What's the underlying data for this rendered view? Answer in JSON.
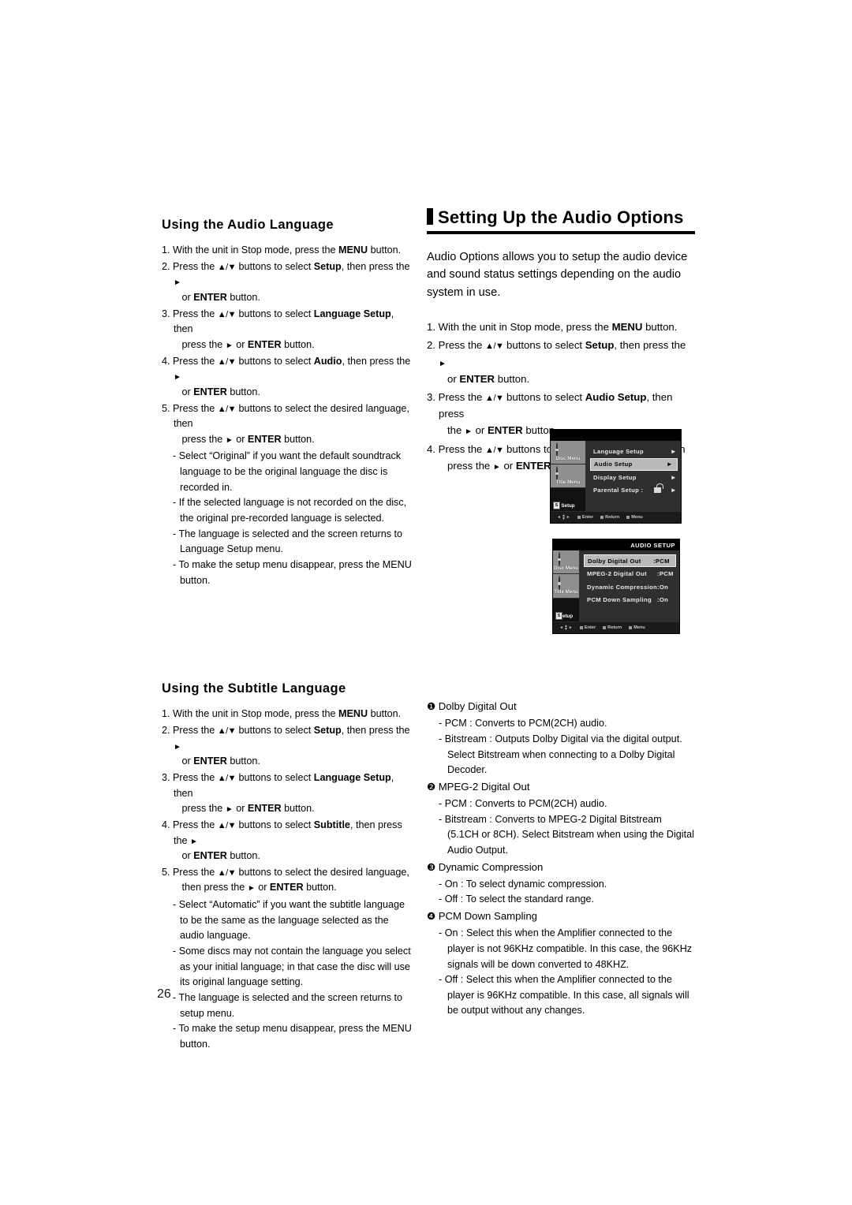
{
  "page_number": "26",
  "left_column": {
    "section1": {
      "title": "Using the Audio Language",
      "steps": [
        "1. With the unit in Stop mode, press the <b>MENU</b> button.",
        "2. Press the <span class=\"tri-ud\"><b>▲</b>/<b>▼</b></span> buttons to select <b>Setup</b>, then press the <span class=\"tri-r\">►</span><br>&nbsp;&nbsp;&nbsp;or <b>ENTER</b> button.",
        "3. Press the <span class=\"tri-ud\"><b>▲</b>/<b>▼</b></span> buttons to select <b>Language Setup</b>, then<br>&nbsp;&nbsp;&nbsp;press the <span class=\"tri-r\">►</span> or <b>ENTER</b> button.",
        "4. Press the <span class=\"tri-ud\"><b>▲</b>/<b>▼</b></span> buttons to select <b>Audio</b>, then press the <span class=\"tri-r\">►</span><br>&nbsp;&nbsp;&nbsp;or <b>ENTER</b> button.",
        "5. Press the <span class=\"tri-ud\"><b>▲</b>/<b>▼</b></span> buttons to select the desired language, then<br>&nbsp;&nbsp;&nbsp;press the <span class=\"tri-r\">►</span> or <b>ENTER</b> button."
      ],
      "sub_notes": [
        "- Select “Original” if you want the default soundtrack language to be the original language the disc is recorded in.",
        "- If the selected language is not recorded on the disc, the original pre-recorded language is selected.",
        "- The language is selected and the screen returns to Language Setup menu.",
        "- To make the setup menu disappear, press the MENU button."
      ]
    },
    "section2": {
      "title": "Using the Subtitle Language",
      "steps": [
        "1. With the unit in Stop mode, press the <b>MENU</b> button.",
        "2. Press the <span class=\"tri-ud\"><b>▲</b>/<b>▼</b></span> buttons to select <b>Setup</b>, then press the <span class=\"tri-r\">►</span><br>&nbsp;&nbsp;&nbsp;or <b>ENTER</b> button.",
        "3. Press the <span class=\"tri-ud\"><b>▲</b>/<b>▼</b></span> buttons to select <b>Language Setup</b>, then<br>&nbsp;&nbsp;&nbsp;press the <span class=\"tri-r\">►</span> or <b>ENTER</b> button.",
        "4. Press the <span class=\"tri-ud\"><b>▲</b>/<b>▼</b></span> buttons to select <b>Subtitle</b>, then press the <span class=\"tri-r\">►</span><br>&nbsp;&nbsp;&nbsp;or <b>ENTER</b> button.",
        "5. Press the <span class=\"tri-ud\"><b>▲</b>/<b>▼</b></span> buttons to select the desired  language,<br>&nbsp;&nbsp;&nbsp;then press the <span class=\"tri-r\">►</span> or <b>ENTER</b> button."
      ],
      "sub_notes": [
        "- Select “Automatic” if you want the subtitle  language to be the same as the language selected as the audio language.",
        "-  Some discs may not contain the language you  select as your initial language; in that case the disc will use its original language setting.",
        "- The language is selected and the screen returns to setup menu.",
        "- To make the setup menu disappear, press the MENU button."
      ]
    }
  },
  "right_column": {
    "title": "Setting Up the Audio Options",
    "intro": "Audio Options allows you to setup the audio device and sound status settings depending on the audio system in use.",
    "steps": [
      "1. With the unit in Stop mode, press the <b>MENU</b> button.",
      "2. Press the <span class=\"tri-ud\"><b>▲</b>/<b>▼</b></span> buttons to select <b>Setup</b>, then press the <span class=\"tri-r\">►</span><br>&nbsp;&nbsp;&nbsp;or <b>ENTER</b> button.",
      "3. Press the <span class=\"tri-ud\"><b>▲</b>/<b>▼</b></span> buttons to select <b>Audio Setup</b>, then press<br>&nbsp;&nbsp;&nbsp;the <span class=\"tri-r\">►</span> or <b>ENTER</b> button.",
      "4. Press the <span class=\"tri-ud\"><b>▲</b>/<b>▼</b></span> buttons to select the desired item, then<br>&nbsp;&nbsp;&nbsp;press the <span class=\"tri-r\">►</span> or <b>ENTER</b> button."
    ],
    "options": [
      {
        "marker": "❶",
        "name": "Dolby Digital Out",
        "details": [
          "- PCM : Converts to PCM(2CH) audio.",
          "- Bitstream : Outputs Dolby Digital via the digital output. Select Bitstream when connecting to a Dolby Digital Decoder."
        ]
      },
      {
        "marker": "❷",
        "name": "MPEG-2 Digital Out",
        "details": [
          "- PCM : Converts to PCM(2CH) audio.",
          "- Bitstream : Converts to MPEG-2 Digital Bitstream (5.1CH or 8CH). Select Bitstream when using the Digital Audio Output."
        ]
      },
      {
        "marker": "❸",
        "name": "Dynamic Compression",
        "details": [
          "- On : To select dynamic compression.",
          "- Off : To select the standard range."
        ]
      },
      {
        "marker": "❹",
        "name": " PCM Down Sampling",
        "details": [
          "- On : Select this when the Amplifier connected to the player is not 96KHz compatible. In this case, the 96KHz signals will be down converted to 48KHZ.",
          "- Off : Select this when the Amplifier connected to the player is 96KHz compatible. In this case, all signals will be  output without any changes."
        ]
      }
    ]
  },
  "osd_setup_menu": {
    "title": "",
    "side_buttons": [
      {
        "label": "Disc Menu",
        "icon": "disc-icon"
      },
      {
        "label": "Title Menu",
        "icon": "disc-icon"
      },
      {
        "label": "Setup",
        "icon": "star-icon",
        "badge": "S"
      }
    ],
    "rows": [
      {
        "label": "Language Setup",
        "arrow": "►",
        "selected": false
      },
      {
        "label": "Audio Setup",
        "arrow": "►",
        "selected": true
      },
      {
        "label": "Display Setup",
        "arrow": "►",
        "selected": false
      },
      {
        "label": "Parental Setup :",
        "arrow": "►",
        "selected": false,
        "lock": true
      }
    ],
    "footer": [
      "Enter",
      "Return",
      "Menu"
    ]
  },
  "osd_audio_setup": {
    "title": "AUDIO SETUP",
    "side_buttons": [
      {
        "label": "Disc Menu",
        "icon": "disc-icon"
      },
      {
        "label": "Title Menu",
        "icon": "disc-icon"
      },
      {
        "label": "Setup",
        "icon": "star-icon",
        "badge": "S"
      }
    ],
    "rows": [
      {
        "label": "Dolby Digital Out",
        "value": ":PCM",
        "selected": true
      },
      {
        "label": "MPEG-2 Digital Out",
        "value": ":PCM",
        "selected": false
      },
      {
        "label": "Dynamic Compression",
        "value": ":On",
        "selected": false
      },
      {
        "label": "PCM Down Sampling",
        "value": ":On",
        "selected": false
      }
    ],
    "footer": [
      "Enter",
      "Return",
      "Menu"
    ]
  }
}
